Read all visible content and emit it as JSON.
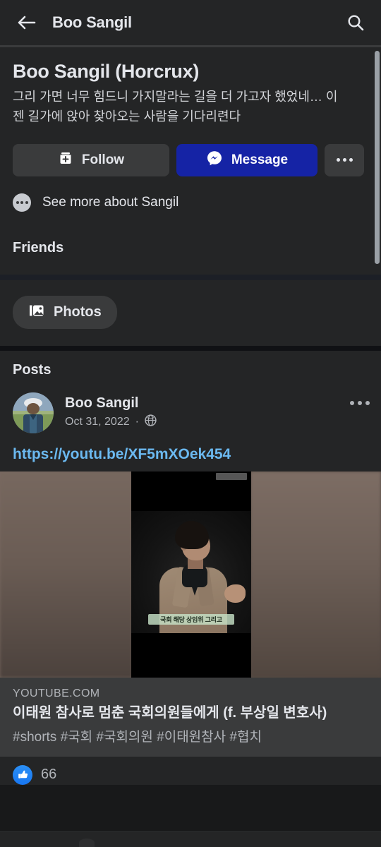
{
  "appbar": {
    "back_icon": "arrow-left-icon",
    "title": "Boo Sangil",
    "search_icon": "search-icon"
  },
  "profile": {
    "name": "Boo Sangil (Horcrux)",
    "bio": "그리 가면 너무 힘드니 가지말라는 길을 더 가고자 했었네… 이젠 길가에 앉아 찾아오는 사람을 기다리련다",
    "actions": {
      "follow_label": "Follow",
      "follow_icon": "add-feed-icon",
      "message_label": "Message",
      "message_icon": "messenger-icon",
      "more_icon": "ellipsis-horizontal-icon"
    },
    "see_more_label": "See more about Sangil",
    "see_more_icon": "ellipsis-circle-icon"
  },
  "sections": {
    "friends_title": "Friends",
    "photos_chip_label": "Photos",
    "photos_chip_icon": "photos-icon",
    "posts_title": "Posts"
  },
  "post": {
    "author": "Boo Sangil",
    "avatar_icon": "user-avatar",
    "date": "Oct 31, 2022",
    "separator": "·",
    "privacy_icon": "globe-icon",
    "menu_icon": "ellipsis-horizontal-icon",
    "link_url": "https://youtu.be/XF5mXOek454",
    "thumbnail": {
      "subtitle_text": "국회 해당 상임위 그리고",
      "watermark": ""
    },
    "link_card": {
      "domain": "YOUTUBE.COM",
      "title": "이태원 참사로 멈춘 국회의원들에게 (f. 부상일 변호사)",
      "subtitle": "#shorts #국회 #국회의원 #이태원참사 #협치"
    },
    "reactions": {
      "like_icon": "thumbs-up-icon",
      "like_count": "66"
    }
  },
  "colors": {
    "background": "#18191a",
    "surface": "#242526",
    "elevated": "#3a3b3c",
    "messenger_blue": "#1523a5",
    "link_blue": "#6bb9f0",
    "like_blue": "#1877f2",
    "text_primary": "#e4e6eb",
    "text_secondary": "#b0b3b8",
    "scrollbar": "#9aa0a6"
  },
  "scrollbar": {
    "name": "vertical-scrollbar"
  }
}
